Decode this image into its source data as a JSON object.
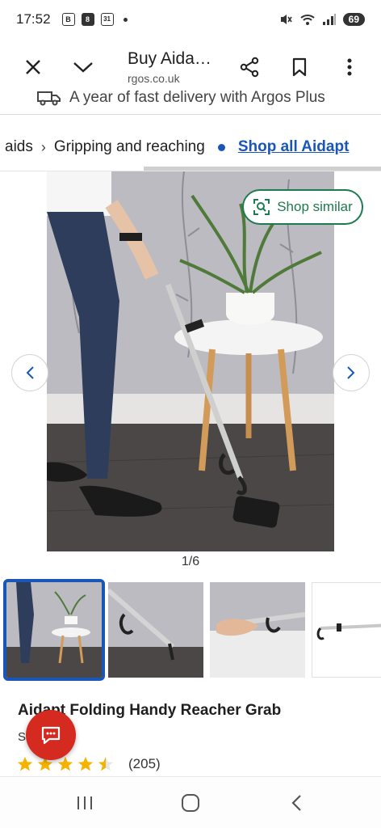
{
  "status_bar": {
    "time": "17:52",
    "notif_icon_1": "B",
    "notif_icon_2": "8",
    "notif_icon_3": "31",
    "battery": "69",
    "icons": [
      "screenshot-icon",
      "notification-icon",
      "calendar-icon",
      "mute-icon",
      "wifi-icon",
      "signal-icon",
      "battery-icon"
    ]
  },
  "toolbar": {
    "page_title": "Buy Aida…",
    "url": "rgos.co.uk",
    "icons": [
      "close-icon",
      "chevron-down-icon",
      "share-icon",
      "bookmark-icon",
      "more-vert-icon"
    ]
  },
  "delivery": {
    "text": "A year of fast delivery with Argos Plus",
    "icon": "delivery-van-icon"
  },
  "breadcrumb": {
    "item_prev": "aids",
    "item_current": "Gripping and reaching",
    "link": "Shop all Aidapt"
  },
  "gallery": {
    "shop_similar": "Shop similar",
    "counter": "1/6",
    "thumbnail_count": 4
  },
  "product": {
    "title": "Aidapt Folding Handy Reacher Grab",
    "code": "S      /4209",
    "rating": 4.5,
    "review_count": "(205)"
  },
  "colors": {
    "accent_blue": "#1a56b8",
    "accent_green": "#1f7a4f",
    "chat_red": "#d42a1f",
    "star_yellow": "#f5b301"
  }
}
